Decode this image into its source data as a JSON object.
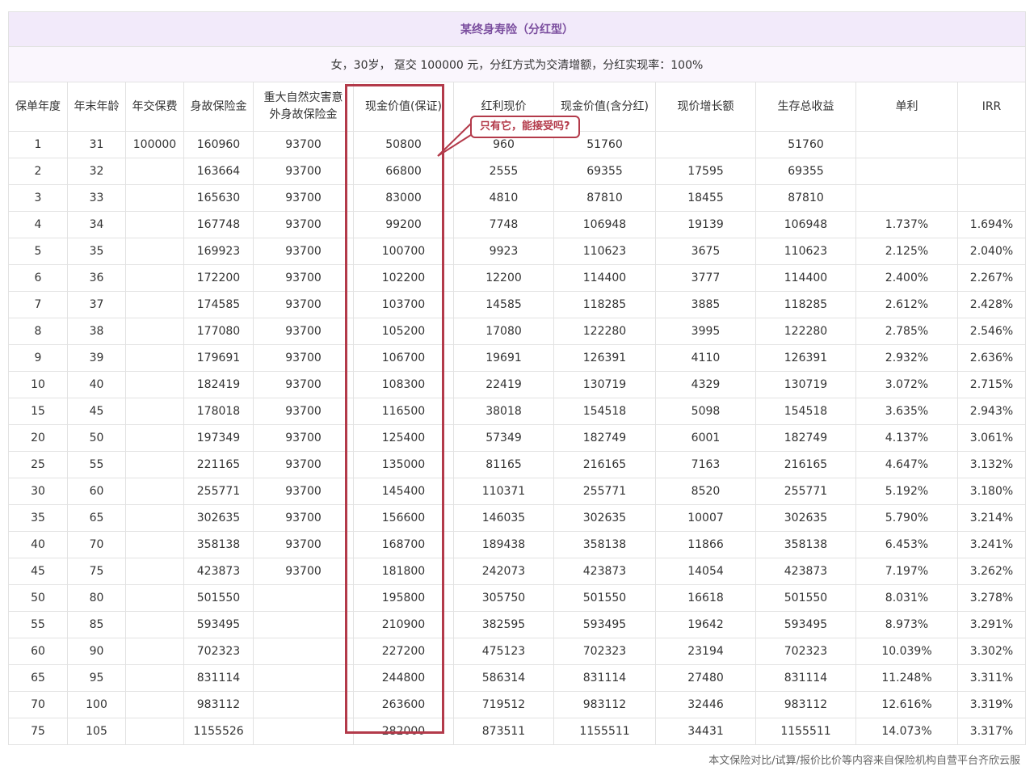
{
  "title": "某终身寿险（分红型）",
  "subtitle": "女，30岁， 趸交 100000 元，分红方式为交清增额，分红实现率：100%",
  "headers": [
    "保单年度",
    "年末年龄",
    "年交保费",
    "身故保险金",
    "重大自然灾害意外身故保险金",
    "现金价值(保证)",
    "红利现价",
    "现金价值(含分红)",
    "现价增长额",
    "生存总收益",
    "单利",
    "IRR"
  ],
  "rows": [
    [
      "1",
      "31",
      "100000",
      "160960",
      "93700",
      "50800",
      "960",
      "51760",
      "",
      "51760",
      "",
      ""
    ],
    [
      "2",
      "32",
      "",
      "163664",
      "93700",
      "66800",
      "2555",
      "69355",
      "17595",
      "69355",
      "",
      ""
    ],
    [
      "3",
      "33",
      "",
      "165630",
      "93700",
      "83000",
      "4810",
      "87810",
      "18455",
      "87810",
      "",
      ""
    ],
    [
      "4",
      "34",
      "",
      "167748",
      "93700",
      "99200",
      "7748",
      "106948",
      "19139",
      "106948",
      "1.737%",
      "1.694%"
    ],
    [
      "5",
      "35",
      "",
      "169923",
      "93700",
      "100700",
      "9923",
      "110623",
      "3675",
      "110623",
      "2.125%",
      "2.040%"
    ],
    [
      "6",
      "36",
      "",
      "172200",
      "93700",
      "102200",
      "12200",
      "114400",
      "3777",
      "114400",
      "2.400%",
      "2.267%"
    ],
    [
      "7",
      "37",
      "",
      "174585",
      "93700",
      "103700",
      "14585",
      "118285",
      "3885",
      "118285",
      "2.612%",
      "2.428%"
    ],
    [
      "8",
      "38",
      "",
      "177080",
      "93700",
      "105200",
      "17080",
      "122280",
      "3995",
      "122280",
      "2.785%",
      "2.546%"
    ],
    [
      "9",
      "39",
      "",
      "179691",
      "93700",
      "106700",
      "19691",
      "126391",
      "4110",
      "126391",
      "2.932%",
      "2.636%"
    ],
    [
      "10",
      "40",
      "",
      "182419",
      "93700",
      "108300",
      "22419",
      "130719",
      "4329",
      "130719",
      "3.072%",
      "2.715%"
    ],
    [
      "15",
      "45",
      "",
      "178018",
      "93700",
      "116500",
      "38018",
      "154518",
      "5098",
      "154518",
      "3.635%",
      "2.943%"
    ],
    [
      "20",
      "50",
      "",
      "197349",
      "93700",
      "125400",
      "57349",
      "182749",
      "6001",
      "182749",
      "4.137%",
      "3.061%"
    ],
    [
      "25",
      "55",
      "",
      "221165",
      "93700",
      "135000",
      "81165",
      "216165",
      "7163",
      "216165",
      "4.647%",
      "3.132%"
    ],
    [
      "30",
      "60",
      "",
      "255771",
      "93700",
      "145400",
      "110371",
      "255771",
      "8520",
      "255771",
      "5.192%",
      "3.180%"
    ],
    [
      "35",
      "65",
      "",
      "302635",
      "93700",
      "156600",
      "146035",
      "302635",
      "10007",
      "302635",
      "5.790%",
      "3.214%"
    ],
    [
      "40",
      "70",
      "",
      "358138",
      "93700",
      "168700",
      "189438",
      "358138",
      "11866",
      "358138",
      "6.453%",
      "3.241%"
    ],
    [
      "45",
      "75",
      "",
      "423873",
      "93700",
      "181800",
      "242073",
      "423873",
      "14054",
      "423873",
      "7.197%",
      "3.262%"
    ],
    [
      "50",
      "80",
      "",
      "501550",
      "",
      "195800",
      "305750",
      "501550",
      "16618",
      "501550",
      "8.031%",
      "3.278%"
    ],
    [
      "55",
      "85",
      "",
      "593495",
      "",
      "210900",
      "382595",
      "593495",
      "19642",
      "593495",
      "8.973%",
      "3.291%"
    ],
    [
      "60",
      "90",
      "",
      "702323",
      "",
      "227200",
      "475123",
      "702323",
      "23194",
      "702323",
      "10.039%",
      "3.302%"
    ],
    [
      "65",
      "95",
      "",
      "831114",
      "",
      "244800",
      "586314",
      "831114",
      "27480",
      "831114",
      "11.248%",
      "3.311%"
    ],
    [
      "70",
      "100",
      "",
      "983112",
      "",
      "263600",
      "719512",
      "983112",
      "32446",
      "983112",
      "12.616%",
      "3.319%"
    ],
    [
      "75",
      "105",
      "",
      "1155526",
      "",
      "282000",
      "873511",
      "1155511",
      "34431",
      "1155511",
      "14.073%",
      "3.317%"
    ]
  ],
  "callout": "只有它，能接受吗?",
  "footer": "本文保险对比/试算/报价比价等内容来自保险机构自营平台齐欣云服",
  "colors": {
    "accent": "#b33a4a",
    "title_bg": "#f2eafa",
    "title_text": "#7a4d9e"
  }
}
